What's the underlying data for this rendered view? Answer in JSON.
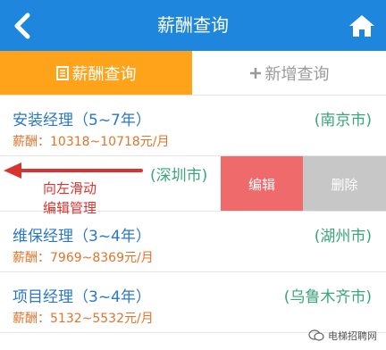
{
  "header": {
    "title": "薪酬查询",
    "back_icon": "chevron-left-icon",
    "home_icon": "home-icon"
  },
  "tabs": [
    {
      "label": "薪酬查询",
      "icon": "document-icon",
      "active": true
    },
    {
      "label": "新增查询",
      "icon": "plus-icon",
      "active": false
    }
  ],
  "items": [
    {
      "job": "安装经理（5~7年）",
      "city": "(南京市)",
      "salary": "薪酬：10318~10718元/月"
    },
    {
      "city": "(深圳市)",
      "edit": "编辑",
      "delete": "删除"
    },
    {
      "job": "维保经理（3~4年）",
      "city": "(湖州市)",
      "salary": "薪酬：7969~8369元/月"
    },
    {
      "job": "项目经理（3~4年）",
      "city": "(乌鲁木齐市)",
      "salary": "薪酬：5132~5532元/月"
    }
  ],
  "annotation": {
    "line1": "向左滑动",
    "line2": "编辑管理"
  },
  "watermark": "电梯招聘网",
  "colors": {
    "header": "#1e86dd",
    "active_tab": "#ffa31a",
    "job": "#2a77c9",
    "city": "#3aa57a",
    "salary": "#e0742c",
    "edit": "#ef6a6a",
    "delete": "#c7c7c7",
    "annotation": "#d8342f"
  }
}
